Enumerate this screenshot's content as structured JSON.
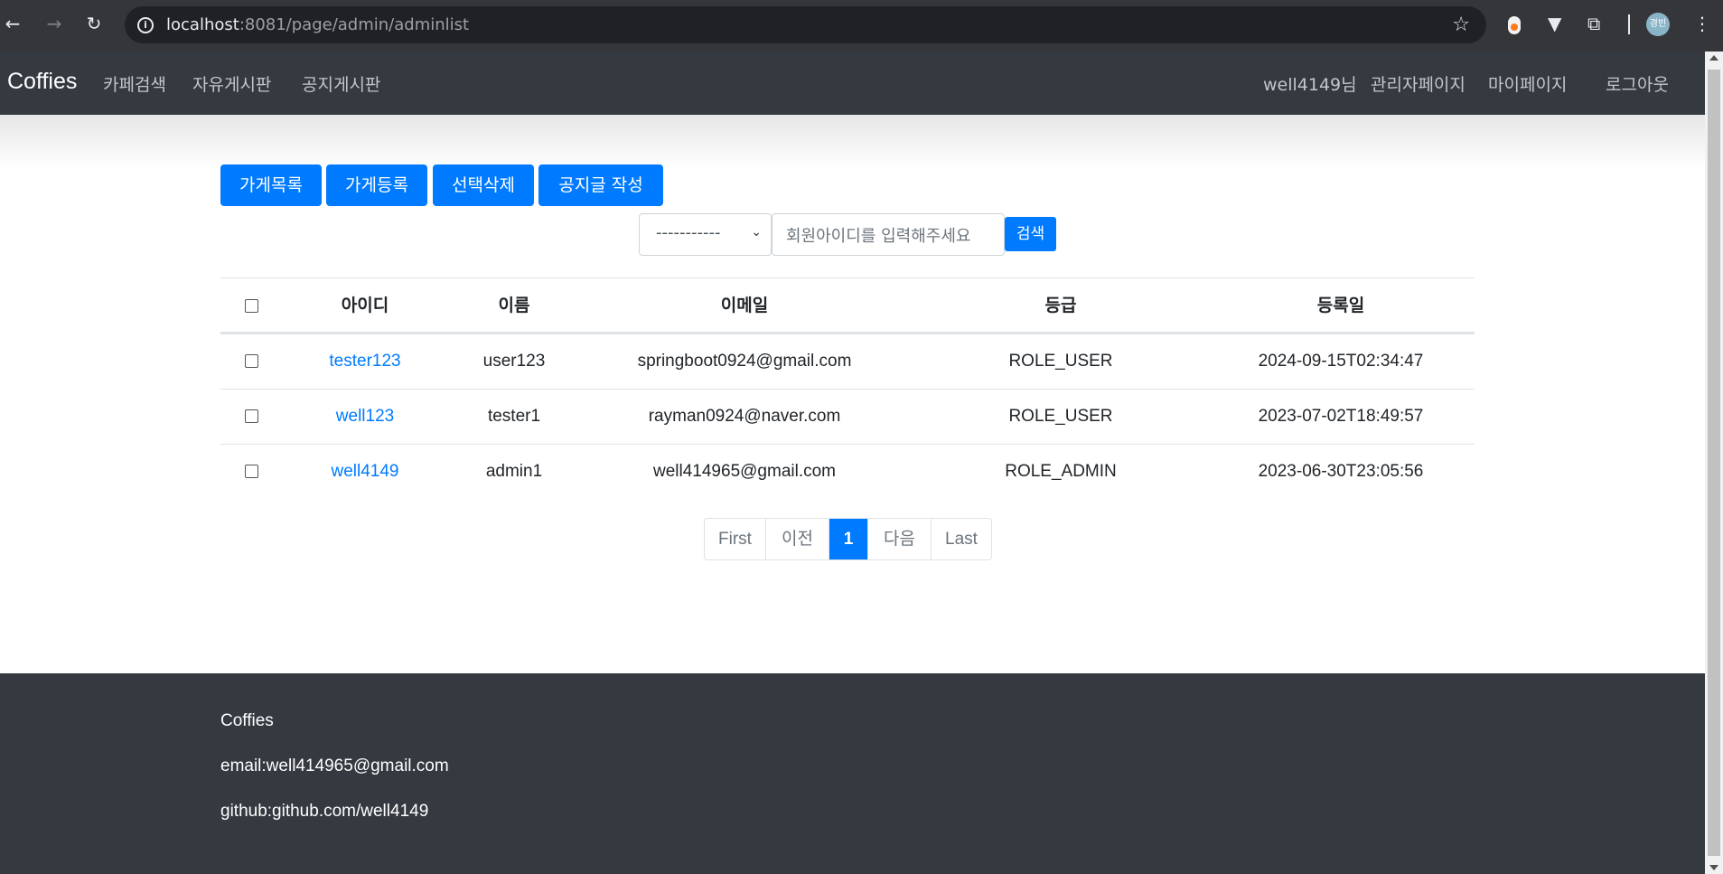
{
  "browser": {
    "url_host": "localhost",
    "url_rest": ":8081/page/admin/adminlist",
    "profile_label": "경빈"
  },
  "navbar": {
    "brand": "Coffies",
    "links": [
      "카페검색",
      "자유게시판",
      "공지게시판"
    ],
    "user_links": [
      "well4149님",
      "관리자페이지",
      "마이페이지",
      "로그아웃"
    ]
  },
  "actions": {
    "buttons": [
      "가게목록",
      "가게등록",
      "선택삭제",
      "공지글 작성"
    ]
  },
  "search": {
    "select_value": "-----------",
    "placeholder": "회원아이디를 입력해주세요",
    "button": "검색"
  },
  "table": {
    "headers": [
      "아이디",
      "이름",
      "이메일",
      "등급",
      "등록일"
    ],
    "rows": [
      {
        "id": "tester123",
        "name": "user123",
        "email": "springboot0924@gmail.com",
        "role": "ROLE_USER",
        "date": "2024-09-15T02:34:47"
      },
      {
        "id": "well123",
        "name": "tester1",
        "email": "rayman0924@naver.com",
        "role": "ROLE_USER",
        "date": "2023-07-02T18:49:57"
      },
      {
        "id": "well4149",
        "name": "admin1",
        "email": "well414965@gmail.com",
        "role": "ROLE_ADMIN",
        "date": "2023-06-30T23:05:56"
      }
    ]
  },
  "pagination": {
    "items": [
      "First",
      "이전",
      "1",
      "다음",
      "Last"
    ],
    "active": "1"
  },
  "footer": {
    "title": "Coffies",
    "email": "email:well414965@gmail.com",
    "github": "github:github.com/well4149"
  },
  "colors": {
    "primary": "#007bff",
    "dark": "#343a40"
  }
}
